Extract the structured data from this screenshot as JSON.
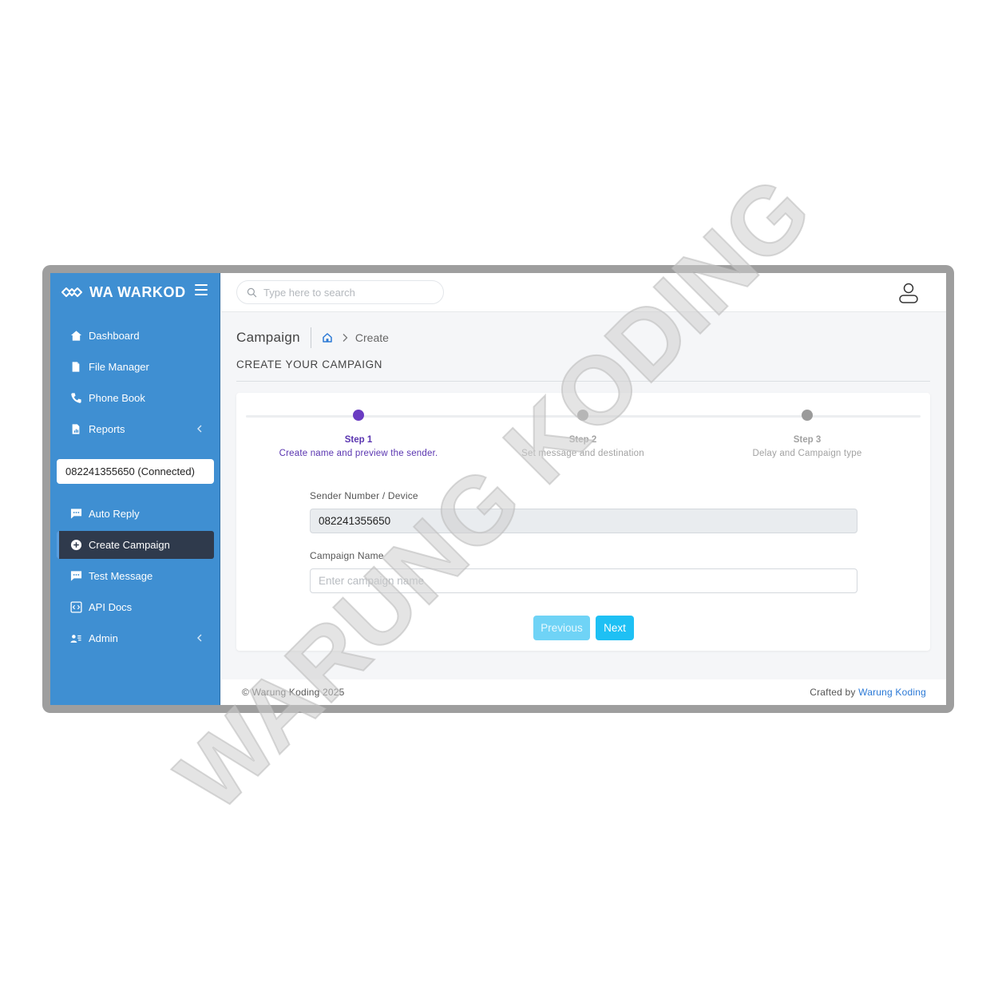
{
  "brand": {
    "name": "WA WARKOD"
  },
  "sidebar": {
    "items": [
      {
        "label": "Dashboard",
        "icon": "home-icon"
      },
      {
        "label": "File Manager",
        "icon": "file-icon"
      },
      {
        "label": "Phone Book",
        "icon": "phone-icon"
      },
      {
        "label": "Reports",
        "icon": "report-icon",
        "expandable": true
      }
    ],
    "device": "082241355650 (Connected)",
    "items2": [
      {
        "label": "Auto Reply",
        "icon": "chat-icon"
      },
      {
        "label": "Create Campaign",
        "icon": "plus-circle-icon",
        "active": true
      },
      {
        "label": "Test Message",
        "icon": "chat-icon"
      },
      {
        "label": "API Docs",
        "icon": "code-icon"
      },
      {
        "label": "Admin",
        "icon": "users-icon",
        "expandable": true
      }
    ]
  },
  "search": {
    "placeholder": "Type here to search"
  },
  "page": {
    "title": "Campaign",
    "breadcrumb": "Create",
    "section_title": "CREATE YOUR CAMPAIGN"
  },
  "steps": [
    {
      "name": "Step 1",
      "desc": "Create name and preview the sender.",
      "current": true
    },
    {
      "name": "Step 2",
      "desc": "Set message and destination",
      "current": false
    },
    {
      "name": "Step 3",
      "desc": "Delay and Campaign type",
      "current": false
    }
  ],
  "form": {
    "sender_label": "Sender Number / Device",
    "sender_value": "082241355650",
    "campaign_label": "Campaign Name",
    "campaign_placeholder": "Enter campaign name"
  },
  "buttons": {
    "previous": "Previous",
    "next": "Next"
  },
  "footer": {
    "copyright": "© Warung Koding 2025",
    "crafted_prefix": "Crafted by",
    "crafted_link": "Warung Koding"
  },
  "watermark": {
    "text": "WARUNG KODING"
  },
  "colors": {
    "sidebar": "#3f8fd2",
    "active_item": "#2f3a4c",
    "step_active": "#6a3cc2",
    "next_button": "#1ec0f4",
    "previous_button": "#6fd3f6",
    "link": "#2b79d6"
  }
}
